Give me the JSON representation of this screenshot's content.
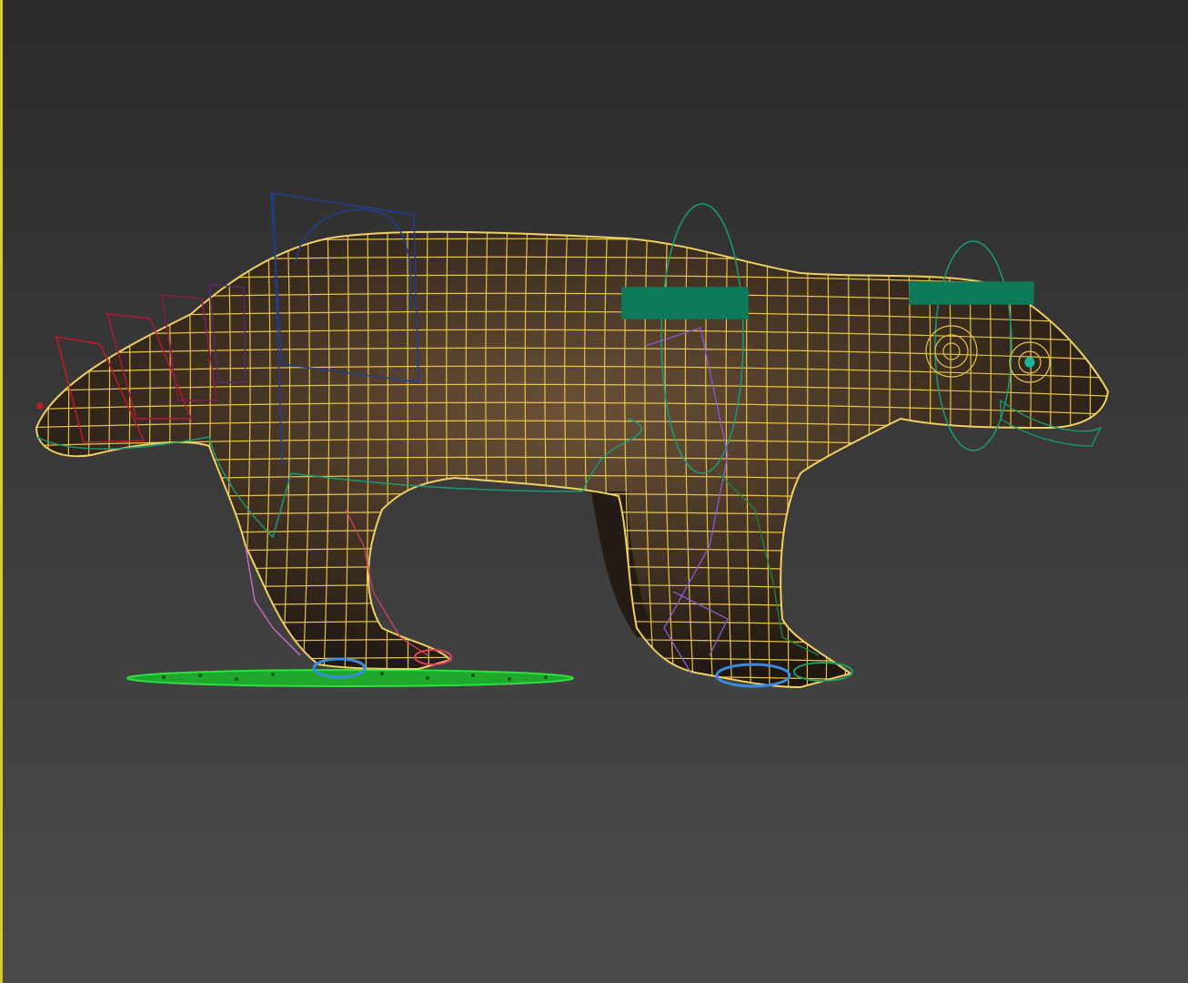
{
  "viewport": {
    "active_border_color": "#d8d020",
    "background_top": "#2b2b2b",
    "background_bottom": "#4a4a4a"
  },
  "model": {
    "mesh_color": "#e6c24a",
    "fur_color": "#4a3a2a",
    "rig_colors": {
      "tail_boxes": "#c41a2a",
      "spine_handle": "#1f3f8f",
      "bone_teal": "#1a9a7a",
      "ground_plane": "#20c030",
      "paw_helpers": "#3a8ae0",
      "leg_helpers": "#8a5ad0"
    }
  }
}
